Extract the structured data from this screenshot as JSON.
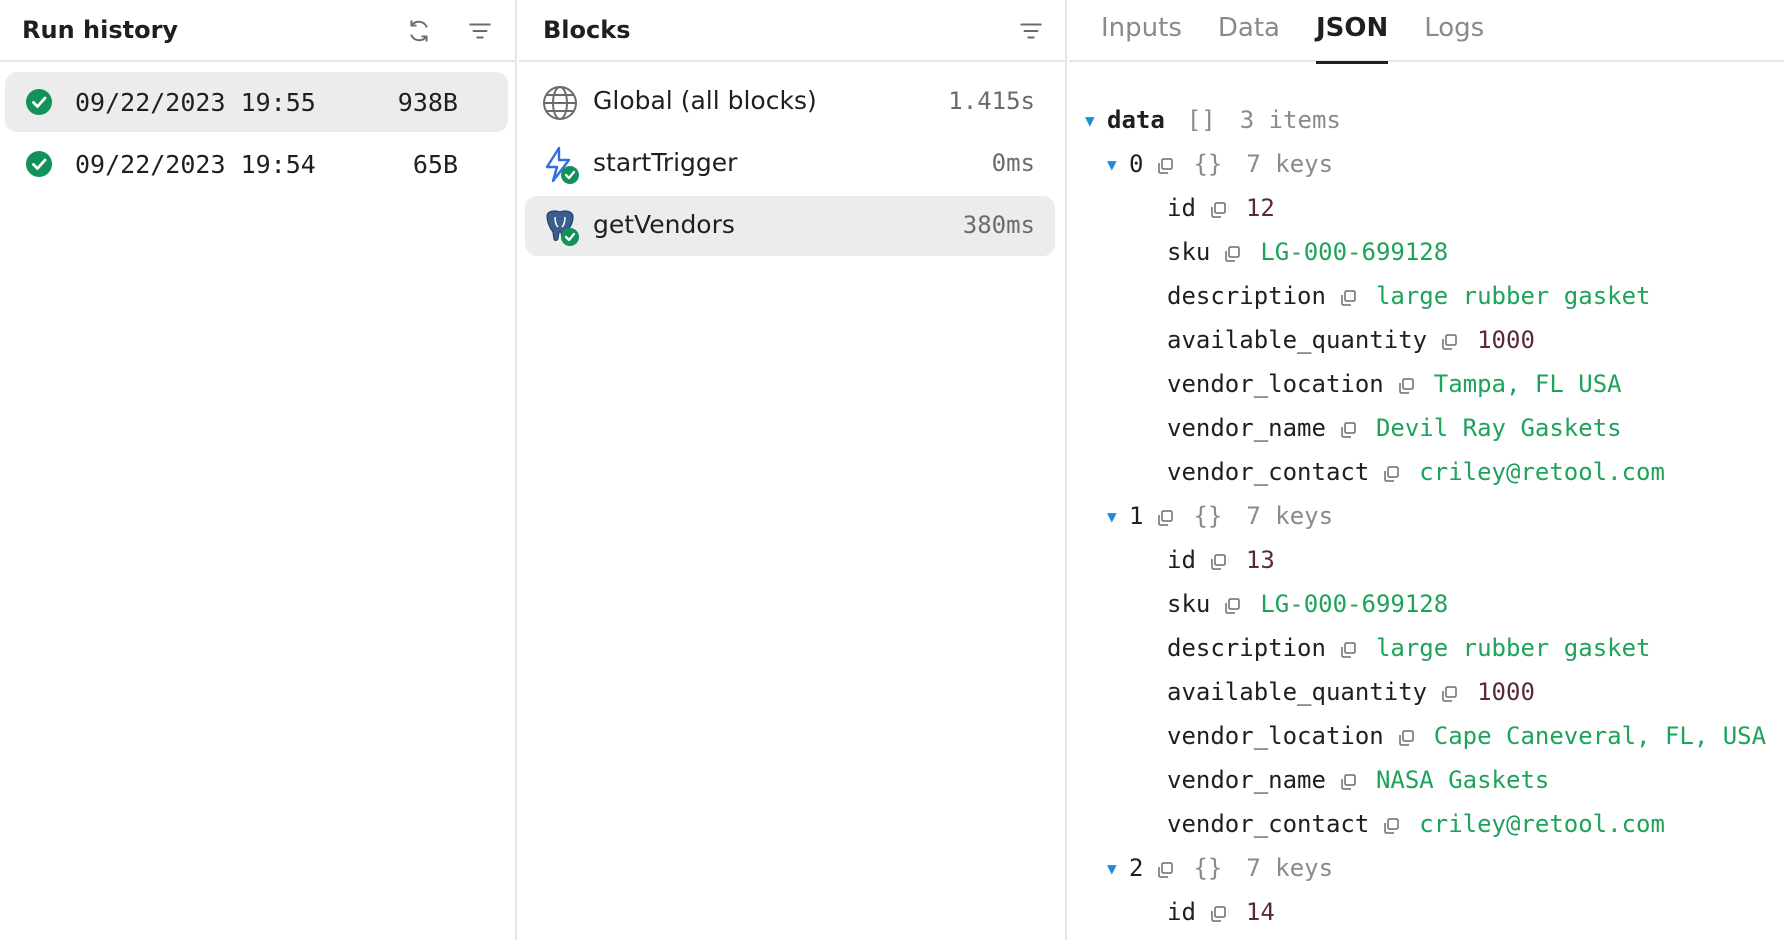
{
  "run_history": {
    "title": "Run history",
    "runs": [
      {
        "time": "09/22/2023 19:55",
        "size": "938B",
        "selected": true
      },
      {
        "time": "09/22/2023 19:54",
        "size": "65B",
        "selected": false
      }
    ]
  },
  "blocks": {
    "title": "Blocks",
    "items": [
      {
        "name": "Global (all blocks)",
        "time": "1.415s",
        "icon": "globe-icon"
      },
      {
        "name": "startTrigger",
        "time": "0ms",
        "icon": "lightning-icon"
      },
      {
        "name": "getVendors",
        "time": "380ms",
        "icon": "postgres-elephant-icon"
      }
    ]
  },
  "tabs": [
    "Inputs",
    "Data",
    "JSON",
    "Logs"
  ],
  "active_tab": "JSON",
  "json_tree": {
    "root_key": "data",
    "root_brackets": "[]",
    "root_meta": "3 items",
    "items": [
      {
        "index": "0",
        "brackets": "{}",
        "meta": "7 keys",
        "fields": [
          {
            "key": "id",
            "value": "12",
            "type": "number"
          },
          {
            "key": "sku",
            "value": "LG-000-699128",
            "type": "string"
          },
          {
            "key": "description",
            "value": "large rubber gasket",
            "type": "string"
          },
          {
            "key": "available_quantity",
            "value": "1000",
            "type": "number"
          },
          {
            "key": "vendor_location",
            "value": "Tampa, FL USA",
            "type": "string"
          },
          {
            "key": "vendor_name",
            "value": "Devil Ray Gaskets",
            "type": "string"
          },
          {
            "key": "vendor_contact",
            "value": "criley@retool.com",
            "type": "string"
          }
        ]
      },
      {
        "index": "1",
        "brackets": "{}",
        "meta": "7 keys",
        "fields": [
          {
            "key": "id",
            "value": "13",
            "type": "number"
          },
          {
            "key": "sku",
            "value": "LG-000-699128",
            "type": "string"
          },
          {
            "key": "description",
            "value": "large rubber gasket",
            "type": "string"
          },
          {
            "key": "available_quantity",
            "value": "1000",
            "type": "number"
          },
          {
            "key": "vendor_location",
            "value": "Cape Caneveral, FL, USA",
            "type": "string"
          },
          {
            "key": "vendor_name",
            "value": "NASA Gaskets",
            "type": "string"
          },
          {
            "key": "vendor_contact",
            "value": "criley@retool.com",
            "type": "string"
          }
        ]
      },
      {
        "index": "2",
        "brackets": "{}",
        "meta": "7 keys",
        "fields": [
          {
            "key": "id",
            "value": "14",
            "type": "number"
          }
        ]
      }
    ]
  },
  "colors": {
    "success_green": "#12915a",
    "string_value": "#1ea35a",
    "number_value": "#5a2a3a",
    "caret_blue": "#1a8fd6",
    "selected_row": "#ececec"
  }
}
